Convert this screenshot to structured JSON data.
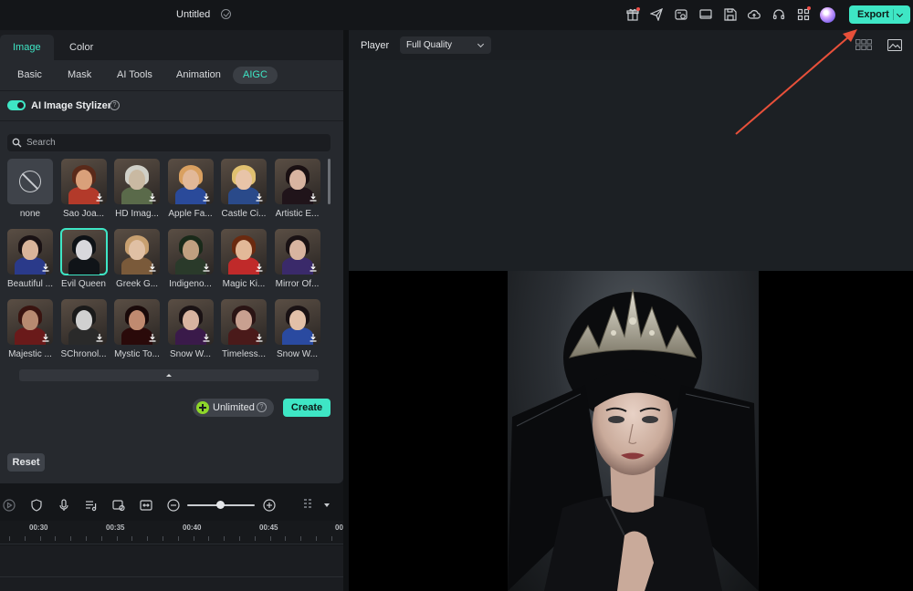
{
  "topbar": {
    "title": "Untitled",
    "export_label": "Export",
    "icons": [
      "gift-icon",
      "send-icon",
      "media-icon",
      "monitor-icon",
      "save-icon",
      "cloud-icon",
      "headset-icon",
      "apps-icon",
      "avatar"
    ]
  },
  "panel": {
    "main_tabs": [
      "Image",
      "Color"
    ],
    "sub_tabs": [
      "Basic",
      "Mask",
      "AI Tools",
      "Animation",
      "AIGC"
    ],
    "stylizer_label": "AI Image Stylizer",
    "search_placeholder": "Search",
    "styles": [
      [
        "none",
        "Sao Joa...",
        "HD Imag...",
        "Apple Fa...",
        "Castle Ci...",
        "Artistic E..."
      ],
      [
        "Beautiful ...",
        "Evil Queen",
        "Greek G...",
        "Indigeno...",
        "Magic Ki...",
        "Mirror Of..."
      ],
      [
        "Majestic ...",
        "SChronol...",
        "Mystic To...",
        "Snow W...",
        "Timeless...",
        "Snow W..."
      ]
    ],
    "selected_style": "Evil Queen",
    "unlimited_label": "Unlimited",
    "create_label": "Create",
    "reset_label": "Reset"
  },
  "timeline": {
    "ruler_labels": [
      "00:30",
      "00:35",
      "00:40",
      "00:45",
      "00"
    ]
  },
  "player": {
    "label": "Player",
    "quality": "Full Quality"
  },
  "colors": {
    "accent": "#3ee6c5",
    "panel_bg": "#26292e",
    "arrow": "#e8503a"
  }
}
